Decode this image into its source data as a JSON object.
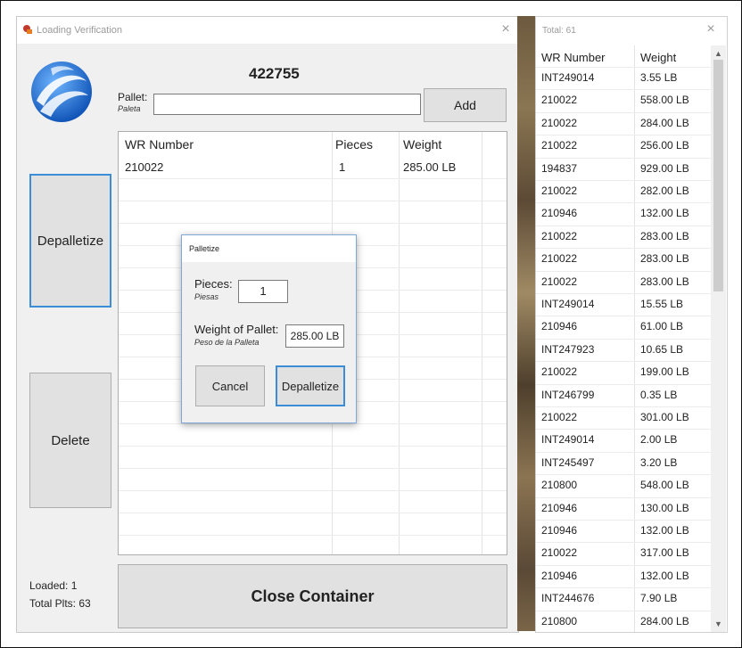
{
  "main_window": {
    "title": "Loading Verification",
    "close_glyph": "×",
    "order_number": "422755",
    "pallet_label": "Pallet:",
    "pallet_label_es": "Paleta",
    "pallet_value": "",
    "add_label": "Add",
    "depalletize_label": "Depalletize",
    "delete_label": "Delete",
    "close_container_label": "Close Container",
    "loaded_text": "Loaded:  1",
    "total_plts_text": "Total Plts: 63",
    "grid": {
      "columns": [
        "WR Number",
        "Pieces",
        "Weight"
      ],
      "rows": [
        {
          "wr": "210022",
          "pieces": "1",
          "weight": "285.00 LB"
        }
      ]
    }
  },
  "dialog": {
    "title": "Palletize",
    "pieces_label": "Pieces:",
    "pieces_label_es": "Piesas",
    "pieces_value": "1",
    "weight_label": "Weight of Pallet:",
    "weight_label_es": "Peso de la Palleta",
    "weight_value": "285.00 LB",
    "cancel_label": "Cancel",
    "depalletize_label": "Depalletize"
  },
  "list_window": {
    "total_text": "Total: 61",
    "close_glyph": "×",
    "columns": [
      "WR Number",
      "Weight"
    ],
    "rows": [
      {
        "wr": "INT249014",
        "weight": "3.55 LB"
      },
      {
        "wr": "210022",
        "weight": "558.00 LB"
      },
      {
        "wr": "210022",
        "weight": "284.00 LB"
      },
      {
        "wr": "210022",
        "weight": "256.00 LB"
      },
      {
        "wr": "194837",
        "weight": "929.00 LB"
      },
      {
        "wr": "210022",
        "weight": "282.00 LB"
      },
      {
        "wr": "210946",
        "weight": "132.00 LB"
      },
      {
        "wr": "210022",
        "weight": "283.00 LB"
      },
      {
        "wr": "210022",
        "weight": "283.00 LB"
      },
      {
        "wr": "210022",
        "weight": "283.00 LB"
      },
      {
        "wr": "INT249014",
        "weight": "15.55 LB"
      },
      {
        "wr": "210946",
        "weight": "61.00 LB"
      },
      {
        "wr": "INT247923",
        "weight": "10.65 LB"
      },
      {
        "wr": "210022",
        "weight": "199.00 LB"
      },
      {
        "wr": "INT246799",
        "weight": "0.35 LB"
      },
      {
        "wr": "210022",
        "weight": "301.00 LB"
      },
      {
        "wr": "INT249014",
        "weight": "2.00 LB"
      },
      {
        "wr": "INT245497",
        "weight": "3.20 LB"
      },
      {
        "wr": "210800",
        "weight": "548.00 LB"
      },
      {
        "wr": "210946",
        "weight": "130.00 LB"
      },
      {
        "wr": "210946",
        "weight": "132.00 LB"
      },
      {
        "wr": "210022",
        "weight": "317.00 LB"
      },
      {
        "wr": "210946",
        "weight": "132.00 LB"
      },
      {
        "wr": "INT244676",
        "weight": "7.90 LB"
      },
      {
        "wr": "210800",
        "weight": "284.00 LB"
      }
    ]
  },
  "colors": {
    "focus_border": "#3c8dd8",
    "logo_blue": "#1f6fd1",
    "window_bg": "#f0f0f0"
  },
  "icons": {
    "app": "loading-app-icon",
    "logo": "company-logo-globe",
    "close": "close-icon",
    "scroll_up": "scroll-up-arrow-icon",
    "scroll_down": "scroll-down-arrow-icon"
  }
}
